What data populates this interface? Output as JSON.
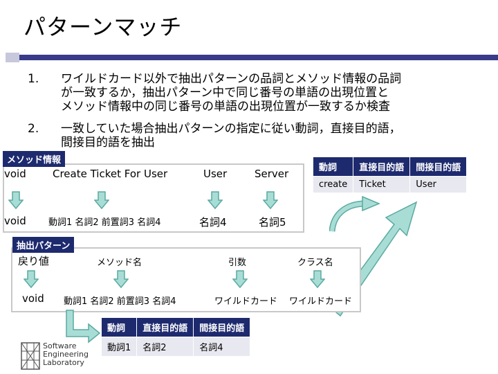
{
  "title": "パターンマッチ",
  "steps": [
    {
      "num": "1.",
      "lines": [
        "ワイルドカード以外で抽出パターンの品詞とメソッド情報の品詞",
        "が一致するか，抽出パターン中で同じ番号の単語の出現位置と",
        "メソッド情報中の同じ番号の単語の出現位置が一致するか検査"
      ]
    },
    {
      "num": "2.",
      "lines": [
        "一致していた場合抽出パターンの指定に従い動詞，直接目的語，",
        "間接目的語を抽出"
      ]
    }
  ],
  "method_info": {
    "tag": "メソッド情報",
    "tokens": [
      "void",
      "Create Ticket For User",
      "User",
      "Server"
    ],
    "pos": [
      "void",
      "動詞1 名詞2 前置詞3 名詞4",
      "名詞4",
      "名詞5"
    ]
  },
  "pattern": {
    "tag": "抽出パターン",
    "headers": [
      "戻り値",
      "メソッド名",
      "引数",
      "クラス名"
    ],
    "values": [
      "void",
      "動詞1 名詞2 前置詞3 名詞4",
      "ワイルドカード",
      "ワイルドカード"
    ]
  },
  "pattern_table": {
    "headers": [
      "動詞",
      "直接目的語",
      "間接目的語"
    ],
    "row": [
      "動詞1",
      "名詞2",
      "名詞4"
    ]
  },
  "result_table": {
    "headers": [
      "動詞",
      "直接目的語",
      "間接目的語"
    ],
    "row": [
      "create",
      "Ticket",
      "User"
    ]
  },
  "logo": {
    "lines": [
      "Software",
      "Engineering",
      "Laboratory"
    ]
  },
  "colors": {
    "accent": "#1e2a6e",
    "arrow_fill": "#a8ddd6",
    "arrow_stroke": "#5aa9a0",
    "box_border": "#c8c8c8"
  }
}
